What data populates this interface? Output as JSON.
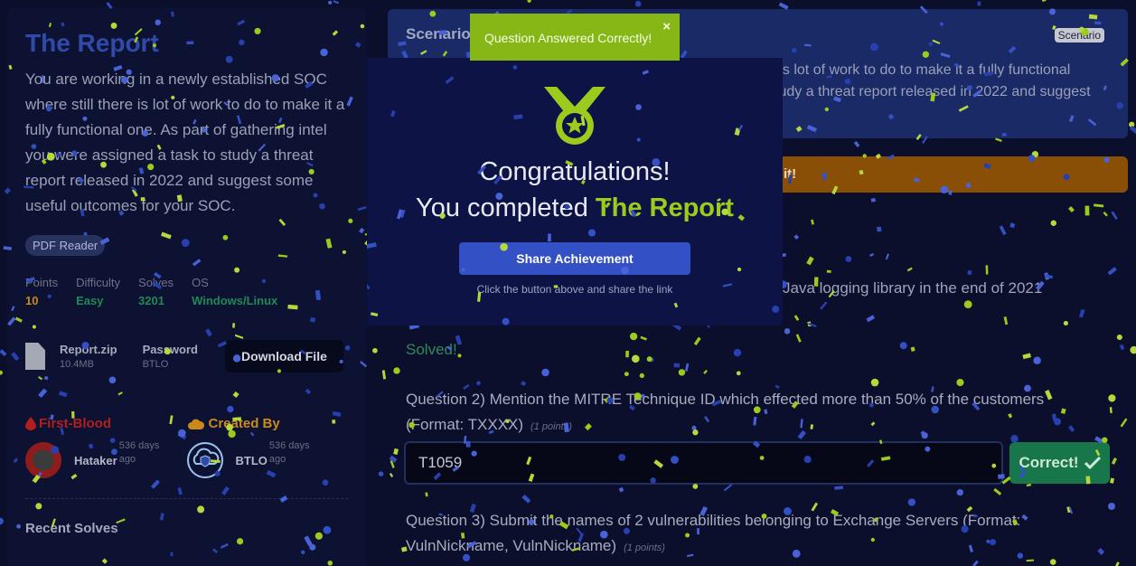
{
  "sidebar": {
    "title": "The Report",
    "description": "You are working in a newly established SOC where still there is lot of work to do to make it a fully functional one. As part of gathering intel you were assigned a task to study a threat report released in 2022 and suggest some useful outcomes for your SOC.",
    "tag": "PDF Reader",
    "stats": [
      {
        "label": "Points",
        "value": "10",
        "color": "#c98a1b"
      },
      {
        "label": "Difficulty",
        "value": "Easy",
        "color": "#1f8a55"
      },
      {
        "label": "Solves",
        "value": "3201",
        "color": "#1f8a55"
      },
      {
        "label": "OS",
        "value": "Windows/Linux",
        "color": "#1f8a55"
      }
    ],
    "file": {
      "name": "Report.zip",
      "size": "10.4MB",
      "password_label": "Password",
      "password": "BTLO",
      "download_label": "Download File"
    },
    "first_blood": {
      "heading": "First-Blood",
      "user": "Hataker",
      "time": "536 days ago",
      "color": "#b01e1e"
    },
    "created_by": {
      "heading": "Created By",
      "user": "BTLO",
      "time": "536 days ago",
      "color": "#c98a1b"
    },
    "recent_heading": "Recent Solves"
  },
  "scenario": {
    "title": "Scenario",
    "badge": "Scenario",
    "text": "e is lot of work to do to make it a fully functional study a threat report released in 2022 and suggest"
  },
  "warning": {
    "text": "it!"
  },
  "questions": {
    "q1_tail": "Java logging library in the end of 2021",
    "solved_label": "Solved!",
    "q2_text": "Question 2) Mention the MITRE Technique ID which effected more than 50% of the customers (Format: TXXXX)",
    "q2_points": "(1 points)",
    "q2_answer": "T1059",
    "correct_label": "Correct!",
    "q3_text": "Question 3) Submit the names of 2 vulnerabilities belonging to Exchange Servers (Format: VulnNickname, VulnNickname)",
    "q3_points": "(1 points)"
  },
  "toast": {
    "text": "Question Answered Correctly!",
    "close": "×"
  },
  "modal": {
    "congrats": "Congratulations!",
    "completed_prefix": "You completed",
    "lab_name": "The Report",
    "share_label": "Share Achievement",
    "share_hint": "Click the button above and share the link"
  },
  "colors": {
    "accent": "#9ccb1d",
    "primary": "#3350c4",
    "success": "#18774a",
    "warning": "#8a4f07"
  }
}
